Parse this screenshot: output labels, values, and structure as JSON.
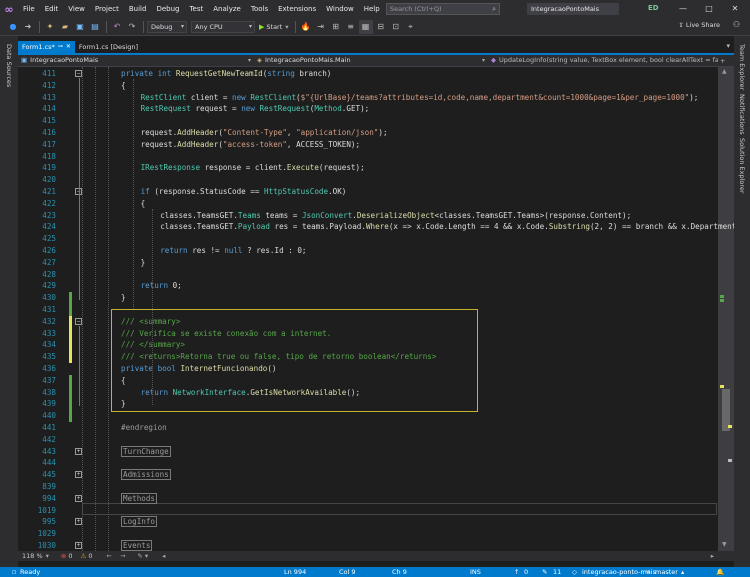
{
  "window": {
    "menu": [
      "File",
      "Edit",
      "View",
      "Project",
      "Build",
      "Debug",
      "Test",
      "Analyze",
      "Tools",
      "Extensions",
      "Window",
      "Help"
    ],
    "search_placeholder": "Search (Ctrl+Q)",
    "solution_name": "IntegracaoPontoMais",
    "user_initials": "ED"
  },
  "toolbar": {
    "configuration": "Debug",
    "platform": "Any CPU",
    "start_label": "Start",
    "live_share": "Live Share"
  },
  "left_panel": {
    "label": "Data Sources"
  },
  "right_panel": {
    "labels": [
      "Team Explorer",
      "Notifications",
      "Solution Explorer"
    ]
  },
  "tabs": [
    {
      "label": "Form1.cs*",
      "active": true
    },
    {
      "label": "Form1.cs [Design]",
      "active": false
    }
  ],
  "navbar": {
    "project": "IntegracaoPontoMais",
    "class": "IntegracaoPontoMais.Main",
    "member": "UpdateLogInfo(string value, TextBox element, bool clearAllText = false"
  },
  "editor": {
    "line_numbers": [
      "411",
      "412",
      "413",
      "414",
      "415",
      "416",
      "417",
      "418",
      "419",
      "420",
      "421",
      "422",
      "423",
      "424",
      "425",
      "426",
      "427",
      "428",
      "429",
      "430",
      "431",
      "432",
      "433",
      "434",
      "435",
      "436",
      "437",
      "438",
      "439",
      "440",
      "441",
      "442",
      "443",
      "444",
      "445",
      "839",
      "994",
      "1019",
      "995",
      "1029",
      "1030"
    ],
    "lines": [
      "private int RequestGetNewTeamId(string branch)",
      "{",
      "RestClient client = new RestClient($\"{UrlBase}/teams?attributes=id,code,name,department&count=1000&page=1&per_page=1000\");",
      "RestRequest request = new RestRequest(Method.GET);",
      "",
      "request.AddHeader(\"Content-Type\", \"application/json\");",
      "request.AddHeader(\"access-token\", ACCESS_TOKEN);",
      "",
      "IRestResponse response = client.Execute(request);",
      "",
      "if (response.StatusCode == HttpStatusCode.OK)",
      "{",
      "classes.TeamsGET.Teams teams = JsonConvert.DeserializeObject<classes.TeamsGET.Teams>(response.Content);",
      "classes.TeamsGET.Payload res = teams.Payload.Where(x => x.Code.Length == 4 && x.Code.Substring(2, 2) == branch && x.Department",
      "",
      "return res != null ? res.Id : 0;",
      "}",
      "",
      "return 0;",
      "}",
      "",
      "/// <summary>",
      "/// Verifica se existe conexão com a internet.",
      "/// </summary>",
      "/// <returns>Retorna true ou false, tipo de retorno boolean</returns>",
      "private bool InternetFuncionando()",
      "{",
      "return NetworkInterface.GetIsNetworkAvailable();",
      "}",
      "",
      "#endregion",
      "",
      "TurnChange",
      "",
      "Admissions",
      "",
      "Methods",
      "",
      "LogInfo",
      "",
      "Events"
    ]
  },
  "editor_footer": {
    "zoom": "118 %",
    "errors": "0",
    "warnings": "0"
  },
  "statusbar": {
    "state": "Ready",
    "ln": "Ln 994",
    "col": "Col 9",
    "ch": "Ch 9",
    "mode": "INS",
    "up": "0",
    "pending": "11",
    "repo": "integracao-ponto-mais",
    "branch": "master"
  }
}
